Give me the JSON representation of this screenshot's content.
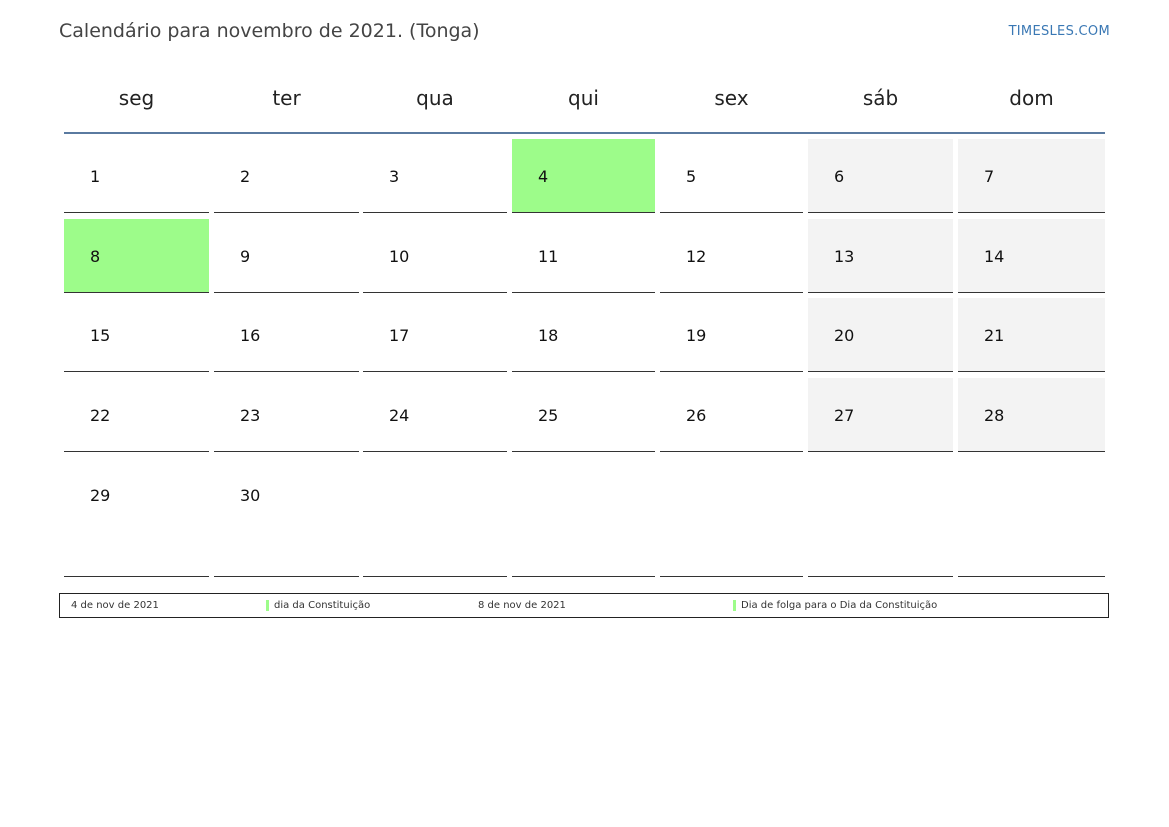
{
  "title": "Calendário para novembro de 2021. (Tonga)",
  "brand": "TIMESLES.COM",
  "colors": {
    "holiday": "#9dfc8a",
    "weekend": "#f3f3f3",
    "header_rule": "#5a7aa0",
    "brand": "#3a78b4"
  },
  "weekdays": [
    "seg",
    "ter",
    "qua",
    "qui",
    "sex",
    "sáb",
    "dom"
  ],
  "weeks": [
    [
      "1",
      "2",
      "3",
      "4",
      "5",
      "6",
      "7"
    ],
    [
      "8",
      "9",
      "10",
      "11",
      "12",
      "13",
      "14"
    ],
    [
      "15",
      "16",
      "17",
      "18",
      "19",
      "20",
      "21"
    ],
    [
      "22",
      "23",
      "24",
      "25",
      "26",
      "27",
      "28"
    ],
    [
      "29",
      "30",
      "",
      "",
      "",
      "",
      ""
    ]
  ],
  "holidays": [
    "4",
    "8"
  ],
  "legend": [
    {
      "date": "4 de nov de 2021",
      "name": "dia da Constituição"
    },
    {
      "date": "8 de nov de 2021",
      "name": "Dia de folga para o Dia da Constituição"
    }
  ]
}
